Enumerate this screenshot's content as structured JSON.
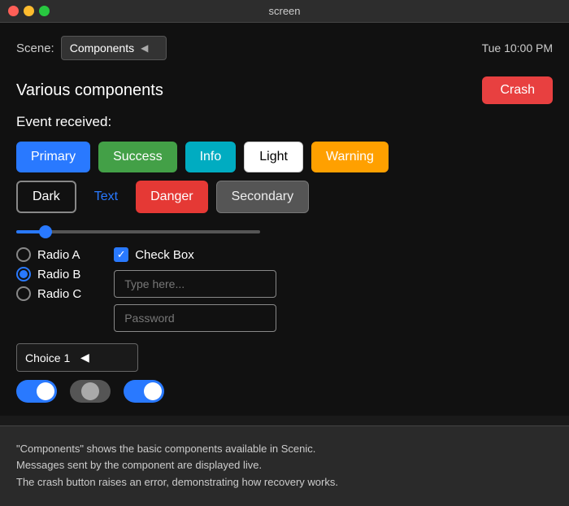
{
  "titleBar": {
    "title": "screen",
    "trafficLights": [
      "red",
      "yellow",
      "green"
    ]
  },
  "sceneRow": {
    "label": "Scene:",
    "sceneValue": "Components",
    "time": "Tue 10:00 PM"
  },
  "main": {
    "componentsTitle": "Various components",
    "crashButton": "Crash",
    "eventLabel": "Event received:",
    "buttons": {
      "row1": [
        {
          "label": "Primary",
          "style": "primary"
        },
        {
          "label": "Success",
          "style": "success"
        },
        {
          "label": "Info",
          "style": "info"
        },
        {
          "label": "Light",
          "style": "light"
        },
        {
          "label": "Warning",
          "style": "warning"
        }
      ],
      "row2": [
        {
          "label": "Dark",
          "style": "dark"
        },
        {
          "label": "Text",
          "style": "text"
        },
        {
          "label": "Danger",
          "style": "danger"
        },
        {
          "label": "Secondary",
          "style": "secondary"
        }
      ]
    },
    "slider": {
      "value": 10,
      "min": 0,
      "max": 100
    },
    "radios": [
      {
        "label": "Radio A",
        "selected": false
      },
      {
        "label": "Radio B",
        "selected": true
      },
      {
        "label": "Radio C",
        "selected": false
      }
    ],
    "checkbox": {
      "label": "Check Box",
      "checked": true
    },
    "inputs": {
      "textPlaceholder": "Type here...",
      "passwordPlaceholder": "Password"
    },
    "dropdown": {
      "value": "Choice 1",
      "arrow": "◀"
    },
    "toggles": [
      {
        "state": "on"
      },
      {
        "state": "mid"
      },
      {
        "state": "on-blue"
      }
    ]
  },
  "infoBar": {
    "line1": "\"Components\" shows the basic components available in Scenic.",
    "line2": "Messages sent by the component are displayed live.",
    "line3": "The crash button raises an error, demonstrating how recovery works."
  }
}
